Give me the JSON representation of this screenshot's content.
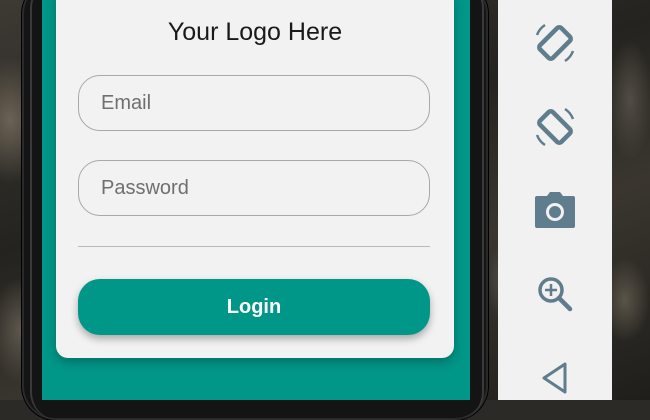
{
  "app": {
    "logo_text": "Your Logo Here"
  },
  "form": {
    "email_placeholder": "Email",
    "email_value": "",
    "password_placeholder": "Password",
    "password_value": "",
    "login_label": "Login"
  },
  "toolbar": {
    "items": [
      {
        "icon": "rotate-left-icon"
      },
      {
        "icon": "rotate-right-icon"
      },
      {
        "icon": "camera-icon"
      },
      {
        "icon": "zoom-in-icon"
      },
      {
        "icon": "back-icon"
      }
    ]
  },
  "colors": {
    "accent": "#009688",
    "card": "#f2f2f2",
    "toolbar_icon": "#5f7d8c",
    "toolbar_bg": "#f1f1f1"
  }
}
